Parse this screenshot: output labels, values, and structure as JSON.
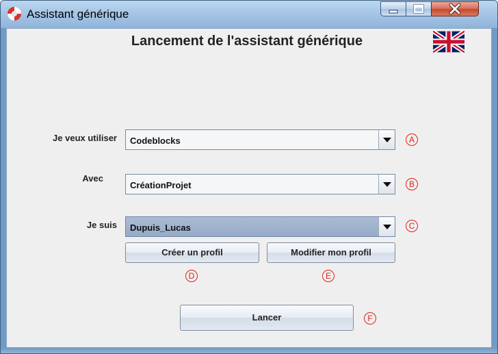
{
  "window": {
    "title": "Assistant générique",
    "icon": "lifebuoy-icon",
    "controls": [
      "minimize-icon",
      "maximize-icon",
      "close-icon"
    ]
  },
  "main": {
    "heading": "Lancement de l'assistant générique",
    "language_flag": "uk-flag-icon",
    "rows": [
      {
        "label": "Je veux utiliser",
        "value": "Codeblocks",
        "marker": "A"
      },
      {
        "label": "Avec",
        "value": "CréationProjet",
        "marker": "B"
      },
      {
        "label": "Je suis",
        "value": "Dupuis_Lucas",
        "marker": "C"
      }
    ],
    "buttons": {
      "create_profile": "Créer un profil",
      "edit_profile": "Modifier mon profil",
      "launch": "Lancer"
    },
    "markers": {
      "create": "D",
      "edit": "E",
      "launch": "F"
    }
  },
  "colors": {
    "marker": "#e0201a",
    "titlebar": "#a6c6e6",
    "selected_combo": "#97acc8"
  }
}
